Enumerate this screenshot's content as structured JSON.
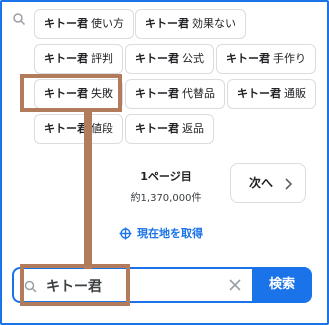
{
  "suggestions": [
    {
      "main": "キトー君",
      "rest": "使い方"
    },
    {
      "main": "キトー君",
      "rest": "効果ない"
    },
    {
      "main": "キトー君",
      "rest": "評判"
    },
    {
      "main": "キトー君",
      "rest": "公式"
    },
    {
      "main": "キトー君",
      "rest": "手作り"
    },
    {
      "main": "キトー君",
      "rest": "失敗"
    },
    {
      "main": "キトー君",
      "rest": "代替品"
    },
    {
      "main": "キトー君",
      "rest": "通販"
    },
    {
      "main": "キトー君",
      "rest": "値段"
    },
    {
      "main": "キトー君",
      "rest": "返品"
    }
  ],
  "pager": {
    "page": "1ページ目",
    "count": "約1,370,000件",
    "next_label": "次へ"
  },
  "location": {
    "label": "現在地を取得"
  },
  "search": {
    "value": "キトー君",
    "button_label": "検索"
  },
  "colors": {
    "accent": "#1a73e8",
    "annotation": "#b27b5b"
  }
}
